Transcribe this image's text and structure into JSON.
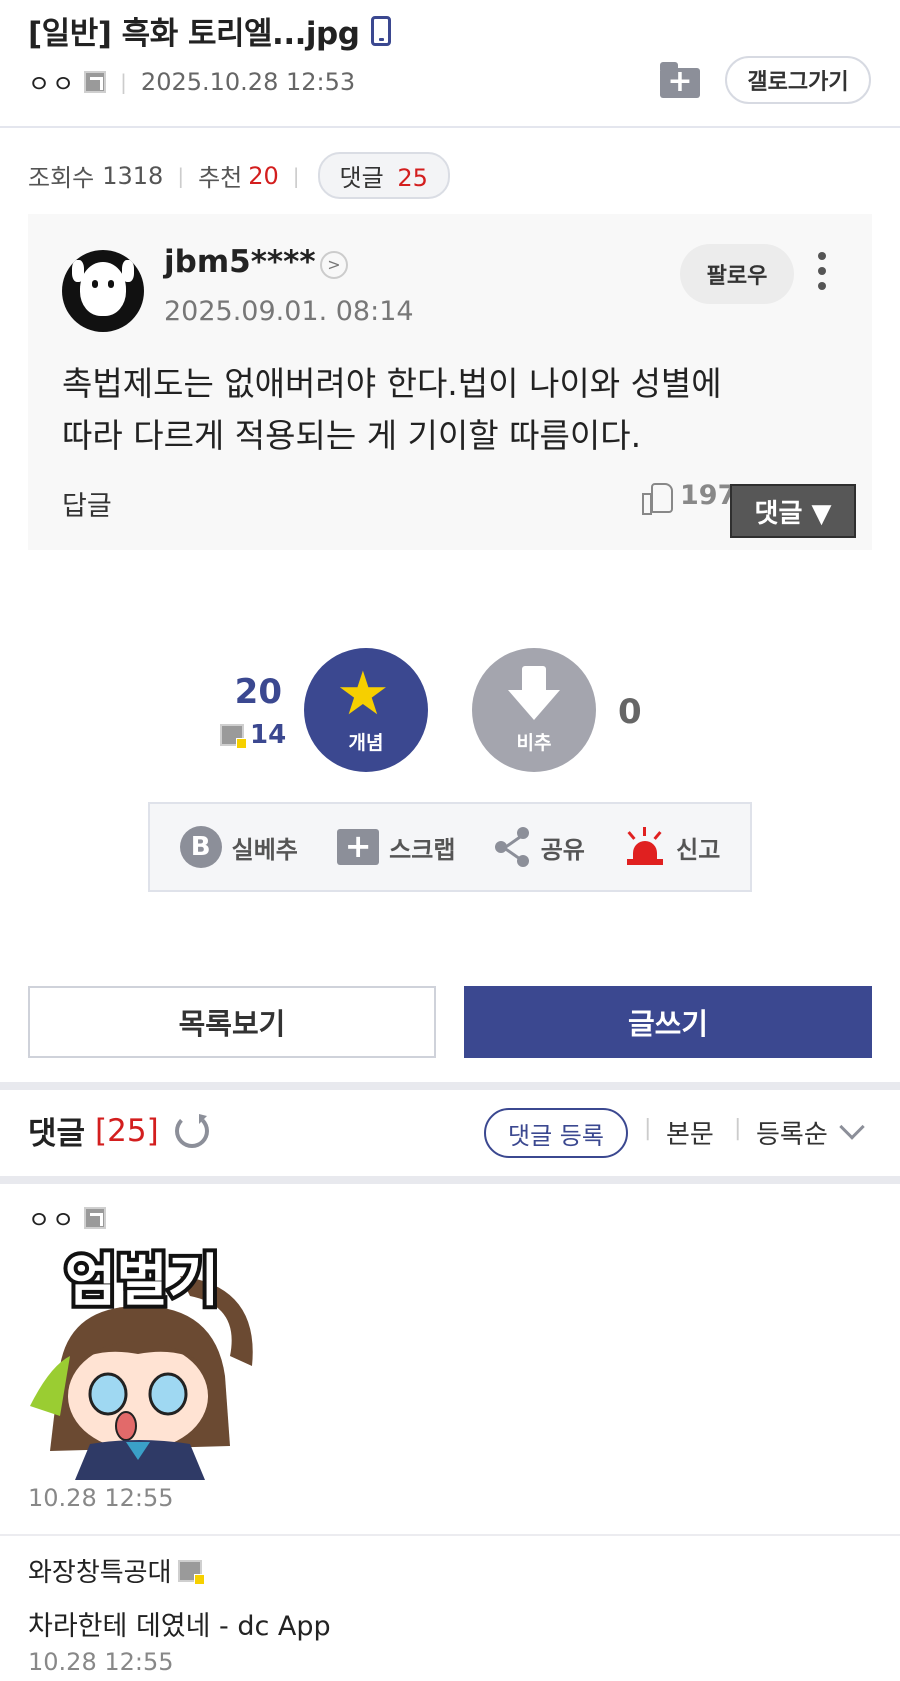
{
  "post": {
    "title": "[일반] 흑화 토리엘...jpg",
    "author": "ㅇㅇ",
    "date": "2025.10.28 12:53",
    "gallog_button": "갤로그가기",
    "stats": {
      "views_label": "조회수",
      "views": "1318",
      "recommend_label": "추천",
      "recommend": "20",
      "comments_label": "댓글",
      "comments": "25"
    }
  },
  "embed": {
    "username": "jbm5****",
    "date": "2025.09.01. 08:14",
    "follow_label": "팔로우",
    "text_line1": "촉법제도는 없애버려야 한다.법이 나이와 성별에",
    "text_line2": "따라 다르게 적용되는 게 기이할 따름이다.",
    "reply_label": "답글",
    "likes": "197",
    "comment_toggle_label": "댓글 ▼"
  },
  "votes": {
    "up_count": "20",
    "fixed_count": "14",
    "up_label": "개념",
    "down_label": "비추",
    "down_count": "0"
  },
  "actions": {
    "best": "실베추",
    "scrap": "스크랩",
    "share": "공유",
    "report": "신고"
  },
  "buttons": {
    "list": "목록보기",
    "write": "글쓰기"
  },
  "comments": {
    "title": "댓글",
    "count": "[25]",
    "register_label": "댓글 등록",
    "body_label": "본문",
    "sort_label": "등록순",
    "items": [
      {
        "author": "ㅇㅇ",
        "sticker_text": "엄벌기",
        "date": "10.28 12:55"
      },
      {
        "author": "와장창특공대",
        "text": "차라한테 데였네 - dc App",
        "date": "10.28 12:55"
      }
    ]
  },
  "colors": {
    "brand": "#3b4890",
    "accent_red": "#d31e1e",
    "star": "#f6cf00",
    "gray_icon": "#8c8f99"
  }
}
